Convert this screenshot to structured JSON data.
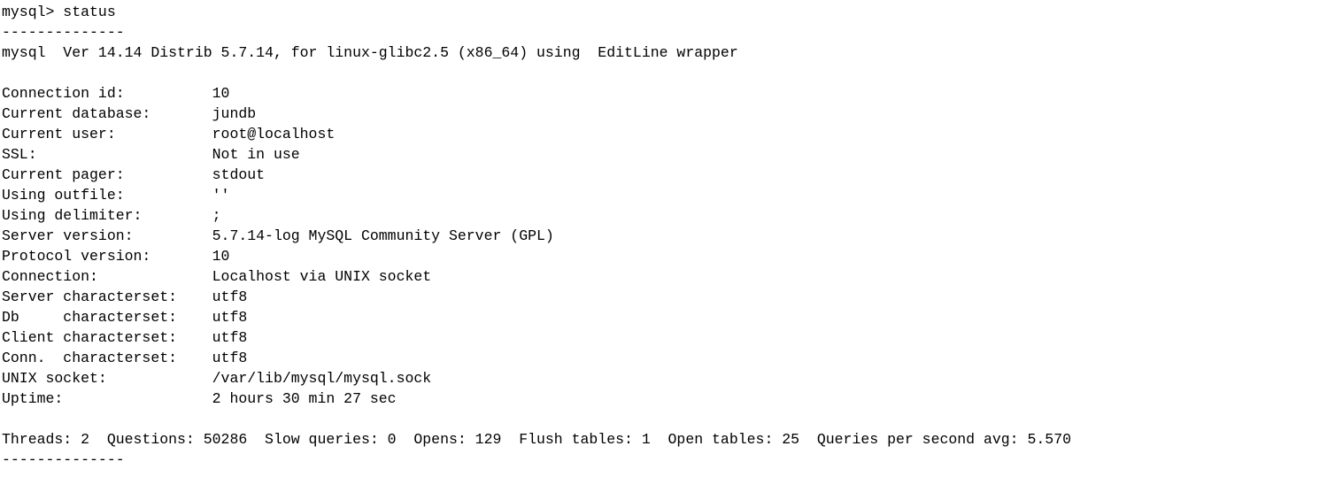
{
  "terminal": {
    "type": "mysql-client-console",
    "background_color": "#ffffff",
    "text_color": "#000000",
    "prompt": "mysql> ",
    "command": "status",
    "prompt_line": "mysql> status",
    "separator_top": "--------------",
    "separator_bottom": "--------------",
    "version_line": "mysql  Ver 14.14 Distrib 5.7.14, for linux-glibc2.5 (x86_64) using  EditLine wrapper",
    "blank_1": "",
    "blank_2": "",
    "status_fields": [
      {
        "label": "Connection id:",
        "value": "10"
      },
      {
        "label": "Current database:",
        "value": "jundb"
      },
      {
        "label": "Current user:",
        "value": "root@localhost"
      },
      {
        "label": "SSL:",
        "value": "Not in use"
      },
      {
        "label": "Current pager:",
        "value": "stdout"
      },
      {
        "label": "Using outfile:",
        "value": "''"
      },
      {
        "label": "Using delimiter:",
        "value": ";"
      },
      {
        "label": "Server version:",
        "value": "5.7.14-log MySQL Community Server (GPL)"
      },
      {
        "label": "Protocol version:",
        "value": "10"
      },
      {
        "label": "Connection:",
        "value": "Localhost via UNIX socket"
      },
      {
        "label": "Server characterset:",
        "value": "utf8"
      },
      {
        "label": "Db     characterset:",
        "value": "utf8"
      },
      {
        "label": "Client characterset:",
        "value": "utf8"
      },
      {
        "label": "Conn.  characterset:",
        "value": "utf8"
      },
      {
        "label": "UNIX socket:",
        "value": "/var/lib/mysql/mysql.sock"
      },
      {
        "label": "Uptime:",
        "value": "2 hours 30 min 27 sec"
      }
    ],
    "status_lines": [
      "Connection id:          10",
      "Current database:       jundb",
      "Current user:           root@localhost",
      "SSL:                    Not in use",
      "Current pager:          stdout",
      "Using outfile:          ''",
      "Using delimiter:        ;",
      "Server version:         5.7.14-log MySQL Community Server (GPL)",
      "Protocol version:       10",
      "Connection:             Localhost via UNIX socket",
      "Server characterset:    utf8",
      "Db     characterset:    utf8",
      "Client characterset:    utf8",
      "Conn.  characterset:    utf8",
      "UNIX socket:            /var/lib/mysql/mysql.sock",
      "Uptime:                 2 hours 30 min 27 sec"
    ],
    "stats_line": "Threads: 2  Questions: 50286  Slow queries: 0  Opens: 129  Flush tables: 1  Open tables: 25  Queries per second avg: 5.570",
    "stats": [
      {
        "label": "Threads:",
        "value": "2"
      },
      {
        "label": "Questions:",
        "value": "50286"
      },
      {
        "label": "Slow queries:",
        "value": "0"
      },
      {
        "label": "Opens:",
        "value": "129"
      },
      {
        "label": "Flush tables:",
        "value": "1"
      },
      {
        "label": "Open tables:",
        "value": "25"
      },
      {
        "label": "Queries per second avg:",
        "value": "5.570"
      }
    ]
  }
}
